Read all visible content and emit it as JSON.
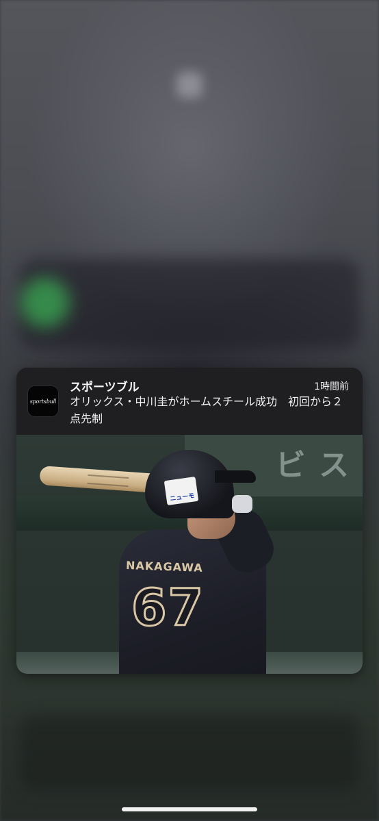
{
  "notification": {
    "app_name": "スポーツブル",
    "timestamp": "1時間前",
    "message": "オリックス・中川圭がホームスチール成功　初回から２点先制",
    "app_icon_text": "sportsbull",
    "app_icon_name": "sportsbull-logo-icon"
  },
  "photo": {
    "jersey_name": "NAKAGAWA",
    "jersey_number": "67",
    "helmet_sticker": "ニューモ",
    "background_sign": "ビ ス"
  }
}
